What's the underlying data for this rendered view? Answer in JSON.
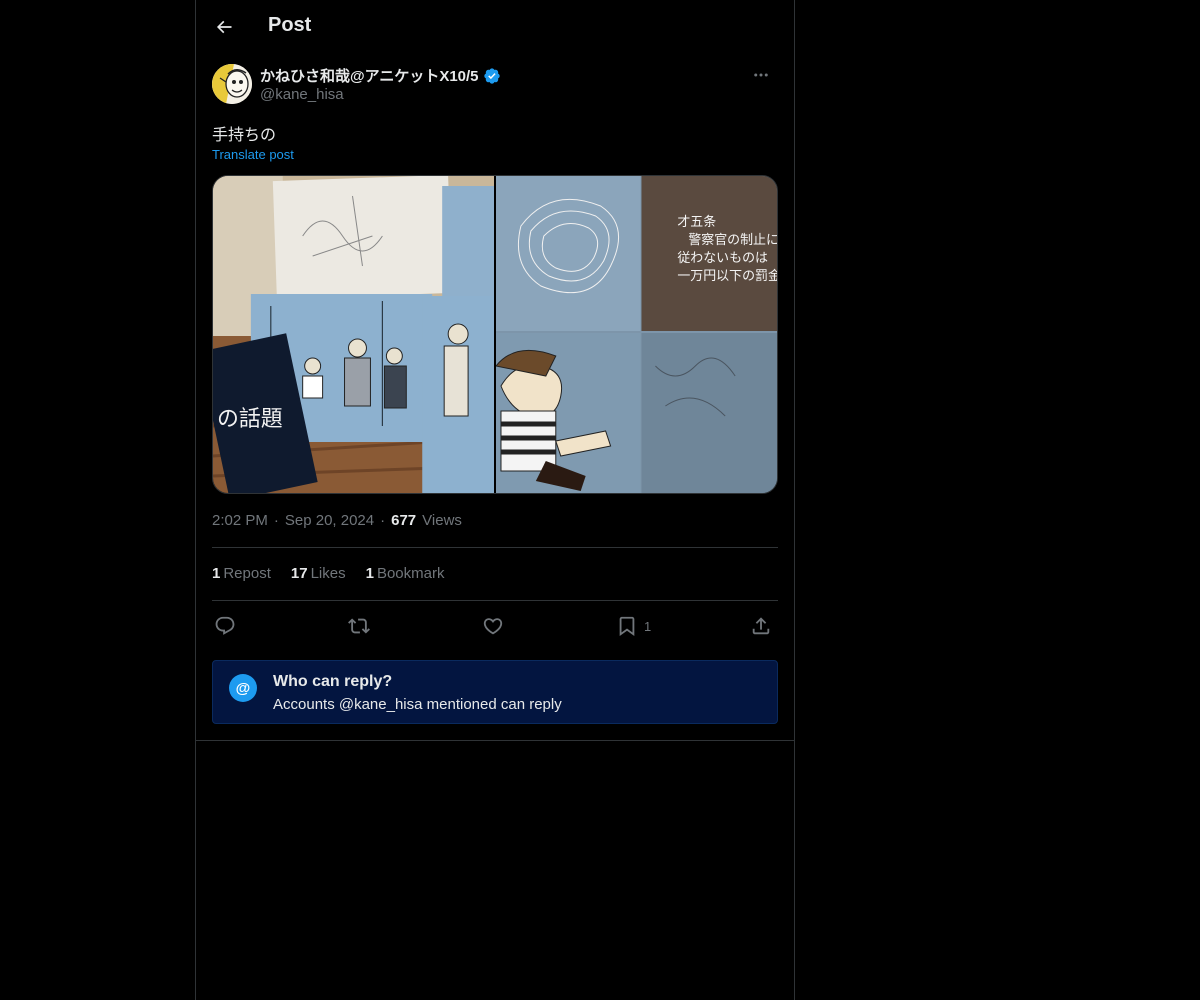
{
  "header": {
    "title": "Post",
    "back_icon": "arrow-left-icon"
  },
  "author": {
    "display_name": "かねひさ和哉@アニケットX10/5",
    "handle": "@kane_hisa",
    "verified": true,
    "verified_color": "#1d9bf0"
  },
  "post": {
    "text": "手持ちの",
    "translate_label": "Translate post",
    "images": [
      {
        "kind": "photo",
        "subject": "sketches and storyboard papers"
      },
      {
        "kind": "photo",
        "subject": "map, text card and cartoon drawings"
      }
    ],
    "image2_caption_lines": [
      "才五条",
      "警察官の制止に",
      "従わないものは",
      "一万円以下の罰金"
    ],
    "image1_book_title": "の話題"
  },
  "meta": {
    "time": "2:02 PM",
    "dot1": "·",
    "date": "Sep 20, 2024",
    "dot2": "·",
    "views_count": "677",
    "views_label": "Views"
  },
  "stats": [
    {
      "count": "1",
      "label": "Repost"
    },
    {
      "count": "17",
      "label": "Likes"
    },
    {
      "count": "1",
      "label": "Bookmark"
    }
  ],
  "actions": {
    "reply_icon": "reply-icon",
    "repost_icon": "repost-icon",
    "like_icon": "heart-icon",
    "bookmark_icon": "bookmark-icon",
    "bookmark_count": "1",
    "share_icon": "share-icon"
  },
  "who_can_reply": {
    "icon_glyph": "@",
    "title": "Who can reply?",
    "subtitle": "Accounts @kane_hisa mentioned can reply"
  },
  "colors": {
    "background": "#000000",
    "border": "#2f3336",
    "text_primary": "#e7e9ea",
    "text_secondary": "#71767b",
    "accent": "#1d9bf0",
    "reply_box_bg": "#031540"
  }
}
